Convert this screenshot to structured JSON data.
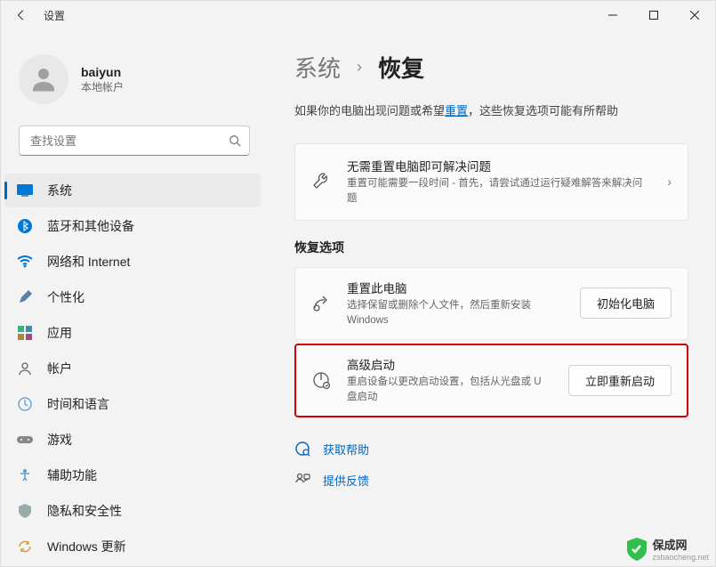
{
  "window": {
    "title": "设置"
  },
  "profile": {
    "name": "baiyun",
    "subtitle": "本地帐户"
  },
  "search": {
    "placeholder": "查找设置"
  },
  "nav": {
    "items": [
      {
        "label": "系统"
      },
      {
        "label": "蓝牙和其他设备"
      },
      {
        "label": "网络和 Internet"
      },
      {
        "label": "个性化"
      },
      {
        "label": "应用"
      },
      {
        "label": "帐户"
      },
      {
        "label": "时间和语言"
      },
      {
        "label": "游戏"
      },
      {
        "label": "辅助功能"
      },
      {
        "label": "隐私和安全性"
      },
      {
        "label": "Windows 更新"
      }
    ]
  },
  "breadcrumb": {
    "parent": "系统",
    "current": "恢复"
  },
  "intro": {
    "pre": "如果你的电脑出现问题或希望",
    "link": "重置",
    "post": "，这些恢复选项可能有所帮助"
  },
  "troubleshoot": {
    "title": "无需重置电脑即可解决问题",
    "desc": "重置可能需要一段时间 - 首先，请尝试通过运行疑难解答来解决问题"
  },
  "section_title": "恢复选项",
  "reset": {
    "title": "重置此电脑",
    "desc": "选择保留或删除个人文件，然后重新安装 Windows",
    "button": "初始化电脑"
  },
  "advanced": {
    "title": "高级启动",
    "desc": "重启设备以更改启动设置，包括从光盘或 U 盘启动",
    "button": "立即重新启动"
  },
  "links": {
    "help": "获取帮助",
    "feedback": "提供反馈"
  },
  "watermark": {
    "text": "保成网",
    "sub": "zsbaocheng.net"
  }
}
